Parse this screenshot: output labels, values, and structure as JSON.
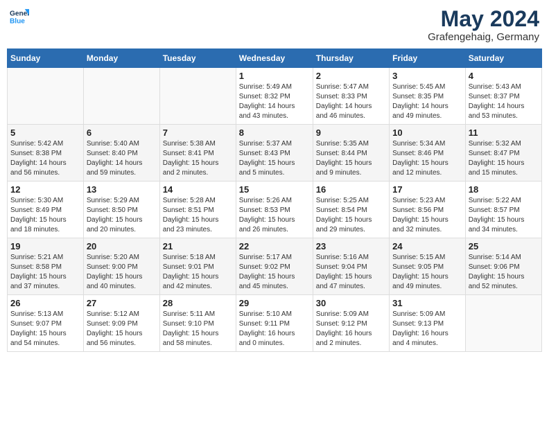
{
  "header": {
    "logo_general": "General",
    "logo_blue": "Blue",
    "main_title": "May 2024",
    "subtitle": "Grafengehaig, Germany"
  },
  "weekdays": [
    "Sunday",
    "Monday",
    "Tuesday",
    "Wednesday",
    "Thursday",
    "Friday",
    "Saturday"
  ],
  "weeks": [
    {
      "days": [
        {
          "num": "",
          "info": ""
        },
        {
          "num": "",
          "info": ""
        },
        {
          "num": "",
          "info": ""
        },
        {
          "num": "1",
          "info": "Sunrise: 5:49 AM\nSunset: 8:32 PM\nDaylight: 14 hours\nand 43 minutes."
        },
        {
          "num": "2",
          "info": "Sunrise: 5:47 AM\nSunset: 8:33 PM\nDaylight: 14 hours\nand 46 minutes."
        },
        {
          "num": "3",
          "info": "Sunrise: 5:45 AM\nSunset: 8:35 PM\nDaylight: 14 hours\nand 49 minutes."
        },
        {
          "num": "4",
          "info": "Sunrise: 5:43 AM\nSunset: 8:37 PM\nDaylight: 14 hours\nand 53 minutes."
        }
      ]
    },
    {
      "days": [
        {
          "num": "5",
          "info": "Sunrise: 5:42 AM\nSunset: 8:38 PM\nDaylight: 14 hours\nand 56 minutes."
        },
        {
          "num": "6",
          "info": "Sunrise: 5:40 AM\nSunset: 8:40 PM\nDaylight: 14 hours\nand 59 minutes."
        },
        {
          "num": "7",
          "info": "Sunrise: 5:38 AM\nSunset: 8:41 PM\nDaylight: 15 hours\nand 2 minutes."
        },
        {
          "num": "8",
          "info": "Sunrise: 5:37 AM\nSunset: 8:43 PM\nDaylight: 15 hours\nand 5 minutes."
        },
        {
          "num": "9",
          "info": "Sunrise: 5:35 AM\nSunset: 8:44 PM\nDaylight: 15 hours\nand 9 minutes."
        },
        {
          "num": "10",
          "info": "Sunrise: 5:34 AM\nSunset: 8:46 PM\nDaylight: 15 hours\nand 12 minutes."
        },
        {
          "num": "11",
          "info": "Sunrise: 5:32 AM\nSunset: 8:47 PM\nDaylight: 15 hours\nand 15 minutes."
        }
      ]
    },
    {
      "days": [
        {
          "num": "12",
          "info": "Sunrise: 5:30 AM\nSunset: 8:49 PM\nDaylight: 15 hours\nand 18 minutes."
        },
        {
          "num": "13",
          "info": "Sunrise: 5:29 AM\nSunset: 8:50 PM\nDaylight: 15 hours\nand 20 minutes."
        },
        {
          "num": "14",
          "info": "Sunrise: 5:28 AM\nSunset: 8:51 PM\nDaylight: 15 hours\nand 23 minutes."
        },
        {
          "num": "15",
          "info": "Sunrise: 5:26 AM\nSunset: 8:53 PM\nDaylight: 15 hours\nand 26 minutes."
        },
        {
          "num": "16",
          "info": "Sunrise: 5:25 AM\nSunset: 8:54 PM\nDaylight: 15 hours\nand 29 minutes."
        },
        {
          "num": "17",
          "info": "Sunrise: 5:23 AM\nSunset: 8:56 PM\nDaylight: 15 hours\nand 32 minutes."
        },
        {
          "num": "18",
          "info": "Sunrise: 5:22 AM\nSunset: 8:57 PM\nDaylight: 15 hours\nand 34 minutes."
        }
      ]
    },
    {
      "days": [
        {
          "num": "19",
          "info": "Sunrise: 5:21 AM\nSunset: 8:58 PM\nDaylight: 15 hours\nand 37 minutes."
        },
        {
          "num": "20",
          "info": "Sunrise: 5:20 AM\nSunset: 9:00 PM\nDaylight: 15 hours\nand 40 minutes."
        },
        {
          "num": "21",
          "info": "Sunrise: 5:18 AM\nSunset: 9:01 PM\nDaylight: 15 hours\nand 42 minutes."
        },
        {
          "num": "22",
          "info": "Sunrise: 5:17 AM\nSunset: 9:02 PM\nDaylight: 15 hours\nand 45 minutes."
        },
        {
          "num": "23",
          "info": "Sunrise: 5:16 AM\nSunset: 9:04 PM\nDaylight: 15 hours\nand 47 minutes."
        },
        {
          "num": "24",
          "info": "Sunrise: 5:15 AM\nSunset: 9:05 PM\nDaylight: 15 hours\nand 49 minutes."
        },
        {
          "num": "25",
          "info": "Sunrise: 5:14 AM\nSunset: 9:06 PM\nDaylight: 15 hours\nand 52 minutes."
        }
      ]
    },
    {
      "days": [
        {
          "num": "26",
          "info": "Sunrise: 5:13 AM\nSunset: 9:07 PM\nDaylight: 15 hours\nand 54 minutes."
        },
        {
          "num": "27",
          "info": "Sunrise: 5:12 AM\nSunset: 9:09 PM\nDaylight: 15 hours\nand 56 minutes."
        },
        {
          "num": "28",
          "info": "Sunrise: 5:11 AM\nSunset: 9:10 PM\nDaylight: 15 hours\nand 58 minutes."
        },
        {
          "num": "29",
          "info": "Sunrise: 5:10 AM\nSunset: 9:11 PM\nDaylight: 16 hours\nand 0 minutes."
        },
        {
          "num": "30",
          "info": "Sunrise: 5:09 AM\nSunset: 9:12 PM\nDaylight: 16 hours\nand 2 minutes."
        },
        {
          "num": "31",
          "info": "Sunrise: 5:09 AM\nSunset: 9:13 PM\nDaylight: 16 hours\nand 4 minutes."
        },
        {
          "num": "",
          "info": ""
        }
      ]
    }
  ]
}
